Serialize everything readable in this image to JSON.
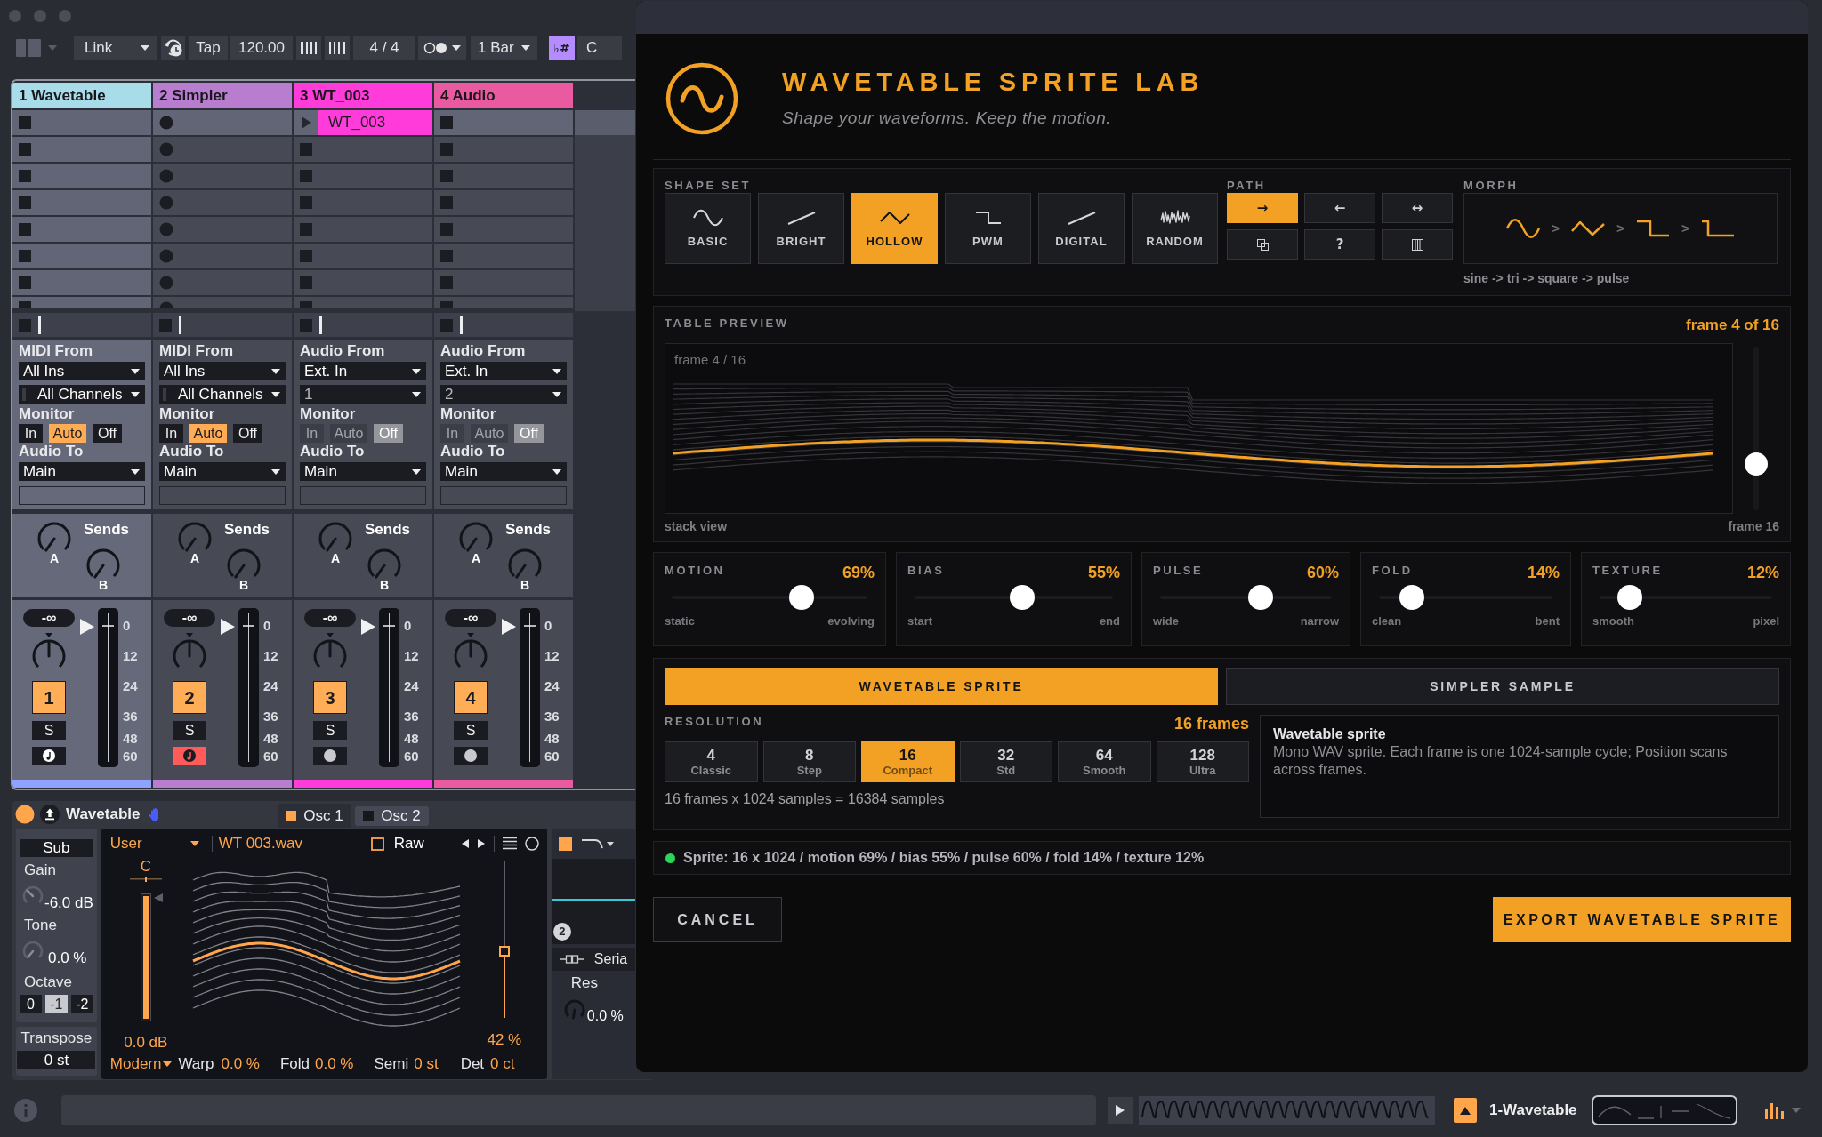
{
  "daw": {
    "toolbar": {
      "link": "Link",
      "tap": "Tap",
      "tempo": "120.00",
      "signature": "4 / 4",
      "quantize": "1 Bar",
      "scale_symbol": "♭#",
      "key": "C"
    },
    "scenes": [
      {
        "selected": true
      },
      {
        "selected": false
      },
      {
        "selected": false
      },
      {
        "selected": false
      },
      {
        "selected": false
      },
      {
        "selected": false
      },
      {
        "selected": false
      }
    ],
    "tracks": [
      {
        "name": "1 Wavetable",
        "color": "#a8dce8",
        "kind": "midi",
        "selected": true,
        "armed": false,
        "input_label": "MIDI From",
        "input": "All Ins",
        "channel": "All Channels",
        "monitor_label": "Monitor",
        "monitor": [
          {
            "label": "In",
            "selected": false
          },
          {
            "label": "Auto",
            "selected": true
          },
          {
            "label": "Off",
            "selected": false
          }
        ],
        "output_label": "Audio To",
        "output": "Main",
        "sends_label": "Sends",
        "sends": [
          "A",
          "B"
        ],
        "volume": "-∞",
        "number": "1",
        "solo": "S",
        "meter_scale": [
          "0",
          "12",
          "24",
          "36",
          "48",
          "60"
        ]
      },
      {
        "name": "2 Simpler",
        "color": "#b87dcf",
        "kind": "midi",
        "selected": false,
        "armed": true,
        "input_label": "MIDI From",
        "input": "All Ins",
        "channel": "All Channels",
        "monitor_label": "Monitor",
        "monitor": [
          {
            "label": "In",
            "selected": false
          },
          {
            "label": "Auto",
            "selected": true
          },
          {
            "label": "Off",
            "selected": false
          }
        ],
        "output_label": "Audio To",
        "output": "Main",
        "sends_label": "Sends",
        "sends": [
          "A",
          "B"
        ],
        "volume": "-∞",
        "number": "2",
        "solo": "S",
        "meter_scale": [
          "0",
          "12",
          "24",
          "36",
          "48",
          "60"
        ]
      },
      {
        "name": "3 WT_003",
        "color": "#ff3cda",
        "kind": "audio",
        "selected": false,
        "armed": false,
        "clip": {
          "name": "WT_003"
        },
        "input_label": "Audio From",
        "input": "Ext. In",
        "channel": "1",
        "monitor_label": "Monitor",
        "monitor": [
          {
            "label": "In",
            "selected": false
          },
          {
            "label": "Auto",
            "selected": false
          },
          {
            "label": "Off",
            "selected": true
          }
        ],
        "output_label": "Audio To",
        "output": "Main",
        "sends_label": "Sends",
        "sends": [
          "A",
          "B"
        ],
        "volume": "-∞",
        "number": "3",
        "solo": "S",
        "meter_scale": [
          "0",
          "12",
          "24",
          "36",
          "48",
          "60"
        ]
      },
      {
        "name": "4 Audio",
        "color": "#e95aa0",
        "kind": "audio",
        "selected": false,
        "armed": false,
        "input_label": "Audio From",
        "input": "Ext. In",
        "channel": "2",
        "monitor_label": "Monitor",
        "monitor": [
          {
            "label": "In",
            "selected": false
          },
          {
            "label": "Auto",
            "selected": false
          },
          {
            "label": "Off",
            "selected": true
          }
        ],
        "output_label": "Audio To",
        "output": "Main",
        "sends_label": "Sends",
        "sends": [
          "A",
          "B"
        ],
        "volume": "-∞",
        "number": "4",
        "solo": "S",
        "meter_scale": [
          "0",
          "12",
          "24",
          "36",
          "48",
          "60"
        ]
      }
    ]
  },
  "device": {
    "name": "Wavetable",
    "on": true,
    "tabs": [
      {
        "label": "Osc 1",
        "on": true,
        "selected": true
      },
      {
        "label": "Osc 2",
        "on": false,
        "selected": false
      }
    ],
    "sub": {
      "label": "Sub",
      "gain_label": "Gain",
      "gain": "-6.0 dB",
      "tone_label": "Tone",
      "tone": "0.0 %",
      "octave_label": "Octave",
      "octaves": [
        {
          "label": "0",
          "selected": false
        },
        {
          "label": "-1",
          "selected": true
        },
        {
          "label": "-2",
          "selected": false
        }
      ],
      "transpose_label": "Transpose",
      "transpose": "0 st"
    },
    "osc": {
      "category": "User",
      "file": "WT 003.wav",
      "raw_label": "Raw",
      "raw": false,
      "note": "C",
      "gain": {
        "value": "0.0 dB",
        "level": 1
      },
      "position": {
        "value": "42 %",
        "level": 0.42
      },
      "mode": "Modern",
      "params": [
        {
          "label": "Warp",
          "value": "0.0 %"
        },
        {
          "label": "Fold",
          "value": "0.0 %"
        },
        {
          "label": "Semi",
          "value": "0 st"
        },
        {
          "label": "Det",
          "value": "0 ct"
        }
      ]
    },
    "filter": {
      "circuit": "2",
      "routing": "Seria",
      "res_label": "Res",
      "res": "0.0 %"
    }
  },
  "status_bar": {
    "track": "1-Wavetable"
  },
  "dialog": {
    "title": "WAVETABLE SPRITE LAB",
    "subtitle": "Shape your waveforms. Keep the motion.",
    "shape_set": {
      "label": "SHAPE SET",
      "items": [
        {
          "label": "BASIC",
          "kind": "sine",
          "selected": false
        },
        {
          "label": "BRIGHT",
          "kind": "saw",
          "selected": false
        },
        {
          "label": "HOLLOW",
          "kind": "triangle",
          "selected": true
        },
        {
          "label": "PWM",
          "kind": "pulse",
          "selected": false
        },
        {
          "label": "DIGITAL",
          "kind": "saw",
          "selected": false
        },
        {
          "label": "RANDOM",
          "kind": "noise",
          "selected": false
        }
      ]
    },
    "path": {
      "label": "PATH",
      "items": [
        {
          "kind": "glyph",
          "glyph": "→",
          "selected": true
        },
        {
          "kind": "glyph",
          "glyph": "←",
          "selected": false
        },
        {
          "kind": "glyph",
          "glyph": "↔",
          "selected": false
        },
        {
          "kind": "layers",
          "selected": false
        },
        {
          "kind": "glyph",
          "glyph": "?",
          "selected": false
        },
        {
          "kind": "columns",
          "selected": false
        }
      ]
    },
    "morph": {
      "label": "MORPH",
      "steps": [
        {
          "kind": "sine"
        },
        {
          "kind": "triangle",
          "separator": ">"
        },
        {
          "kind": "square",
          "separator": ">"
        },
        {
          "kind": "pulse",
          "separator": ">"
        }
      ],
      "caption": "sine -> tri -> square -> pulse"
    },
    "preview": {
      "label": "TABLE PREVIEW",
      "readout": "frame 4 of 16",
      "overlay": "frame 4 / 16",
      "level": 0.25,
      "foot_left": "stack view",
      "foot_right": "frame 16"
    },
    "params": [
      {
        "label": "MOTION",
        "value": "69%",
        "level": 0.69,
        "min": "static",
        "max": "evolving"
      },
      {
        "label": "BIAS",
        "value": "55%",
        "level": 0.55,
        "min": "start",
        "max": "end"
      },
      {
        "label": "PULSE",
        "value": "60%",
        "level": 0.6,
        "min": "wide",
        "max": "narrow"
      },
      {
        "label": "FOLD",
        "value": "14%",
        "level": 0.14,
        "min": "clean",
        "max": "bent"
      },
      {
        "label": "TEXTURE",
        "value": "12%",
        "level": 0.12,
        "min": "smooth",
        "max": "pixel"
      }
    ],
    "outputs": [
      {
        "label": "WAVETABLE SPRITE",
        "selected": true
      },
      {
        "label": "SIMPLER SAMPLE",
        "selected": false
      }
    ],
    "resolution": {
      "label": "RESOLUTION",
      "readout": "16 frames",
      "options": [
        {
          "value": "4",
          "name": "Classic",
          "selected": false
        },
        {
          "value": "8",
          "name": "Step",
          "selected": false
        },
        {
          "value": "16",
          "name": "Compact",
          "selected": true
        },
        {
          "value": "32",
          "name": "Std",
          "selected": false
        },
        {
          "value": "64",
          "name": "Smooth",
          "selected": false
        },
        {
          "value": "128",
          "name": "Ultra",
          "selected": false
        }
      ],
      "summary": "16 frames x 1024 samples = 16384 samples"
    },
    "info": {
      "title": "Wavetable sprite",
      "text": "Mono WAV sprite. Each frame is one 1024-sample cycle; Position scans across frames."
    },
    "status": {
      "ready": true,
      "text": "Sprite: 16 x 1024 / motion 69% / bias 55% / pulse 60% / fold 14% / texture 12%"
    },
    "cancel": "CANCEL",
    "export": "EXPORT WAVETABLE SPRITE"
  }
}
